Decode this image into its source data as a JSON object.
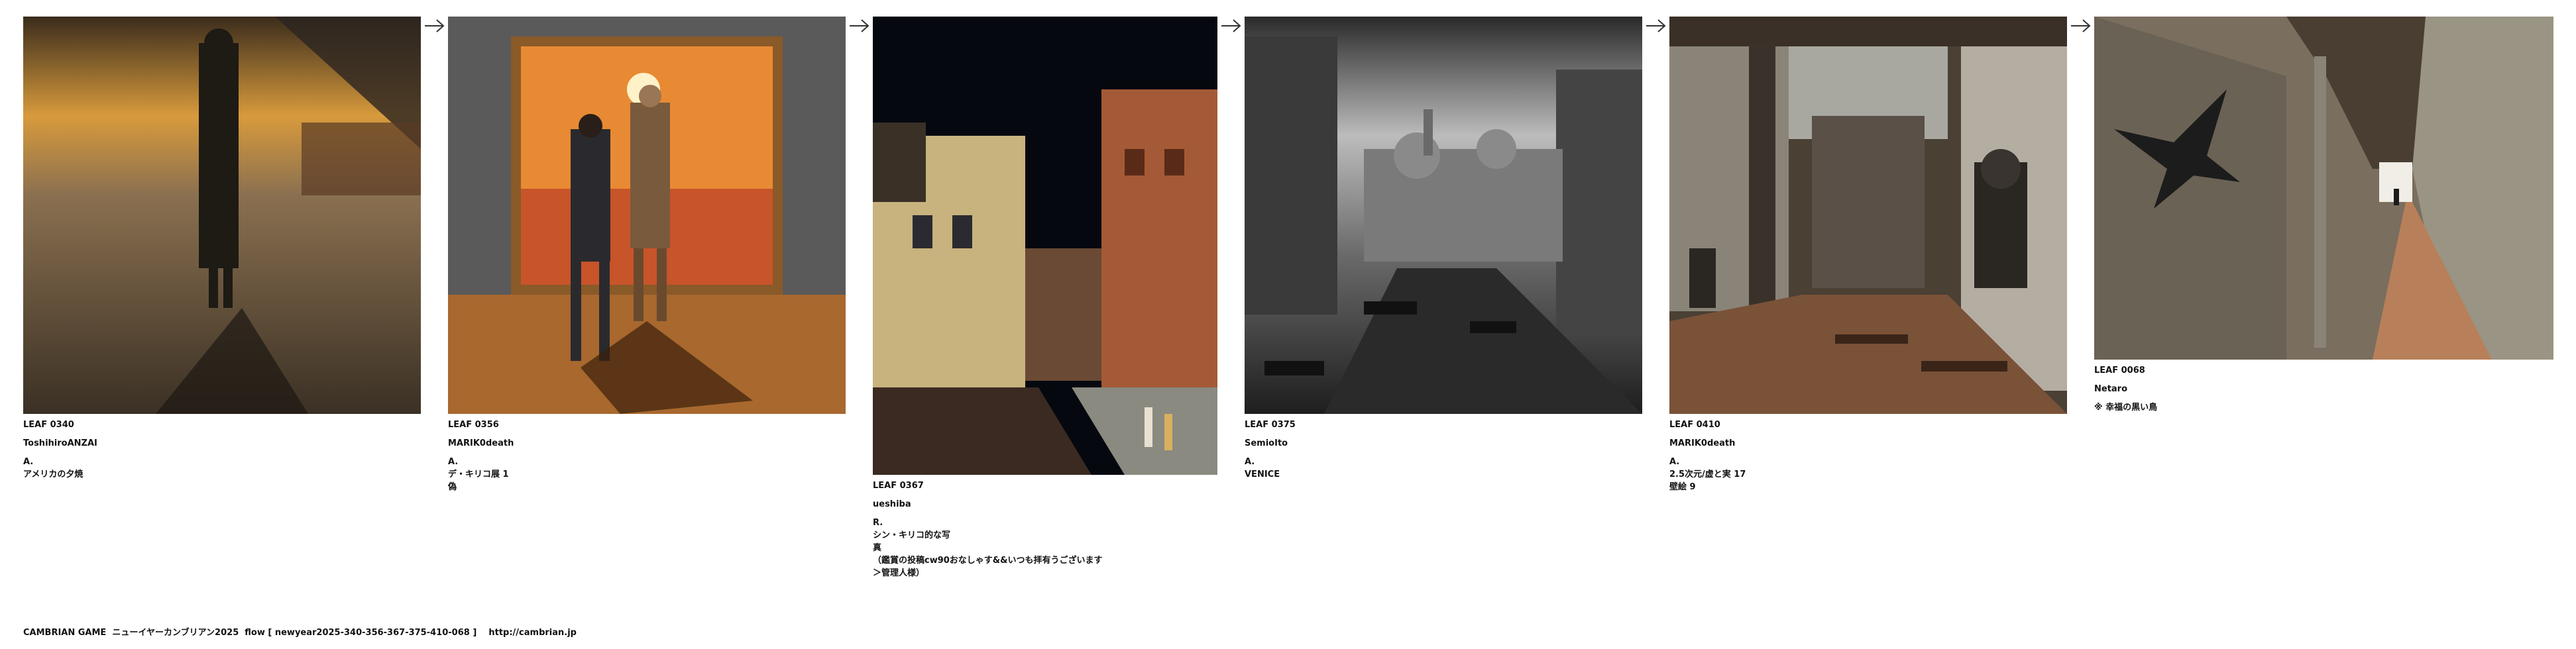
{
  "leaves": [
    {
      "no": "LEAF 0340",
      "author": "ToshihiroANZAI",
      "mark": "A.",
      "title": "アメリカの夕焼",
      "image": "painting-man-walking-sunset"
    },
    {
      "no": "LEAF 0356",
      "author": "MARIK0death",
      "mark": "A.",
      "title": "デ・キリコ展 1\n偽",
      "image": "gallery-painting-sunset-two-men"
    },
    {
      "no": "LEAF 0367",
      "author": "ueshiba",
      "mark": "R.",
      "title": "シン・キリコ的な写\n真\n（鑑賞の投稿cw90おなしゃす&&いつも拝有うございます\n＞管理人様）",
      "image": "photo-venice-night-canal"
    },
    {
      "no": "LEAF 0375",
      "author": "SemioIto",
      "mark": "A.",
      "title": "VENICE",
      "image": "monochrome-venice-ruins"
    },
    {
      "no": "LEAF 0410",
      "author": "MARIK0death",
      "mark": "A.",
      "title": "2.5次元/虚と実 17\n壁絵 9",
      "image": "ruined-canal-mural"
    },
    {
      "no": "LEAF 0068",
      "author": "Netaro",
      "mark": "※ 幸福の黒い鳥",
      "title": "",
      "image": "corridor-black-bird"
    }
  ],
  "footer": "CAMBRIAN GAME  ニューイヤーカンブリアン2025  flow [ newyear2025-340-356-367-375-410-068 ]    http://cambrian.jp",
  "colors": {
    "text": "#111111",
    "arrow": "#333333"
  }
}
